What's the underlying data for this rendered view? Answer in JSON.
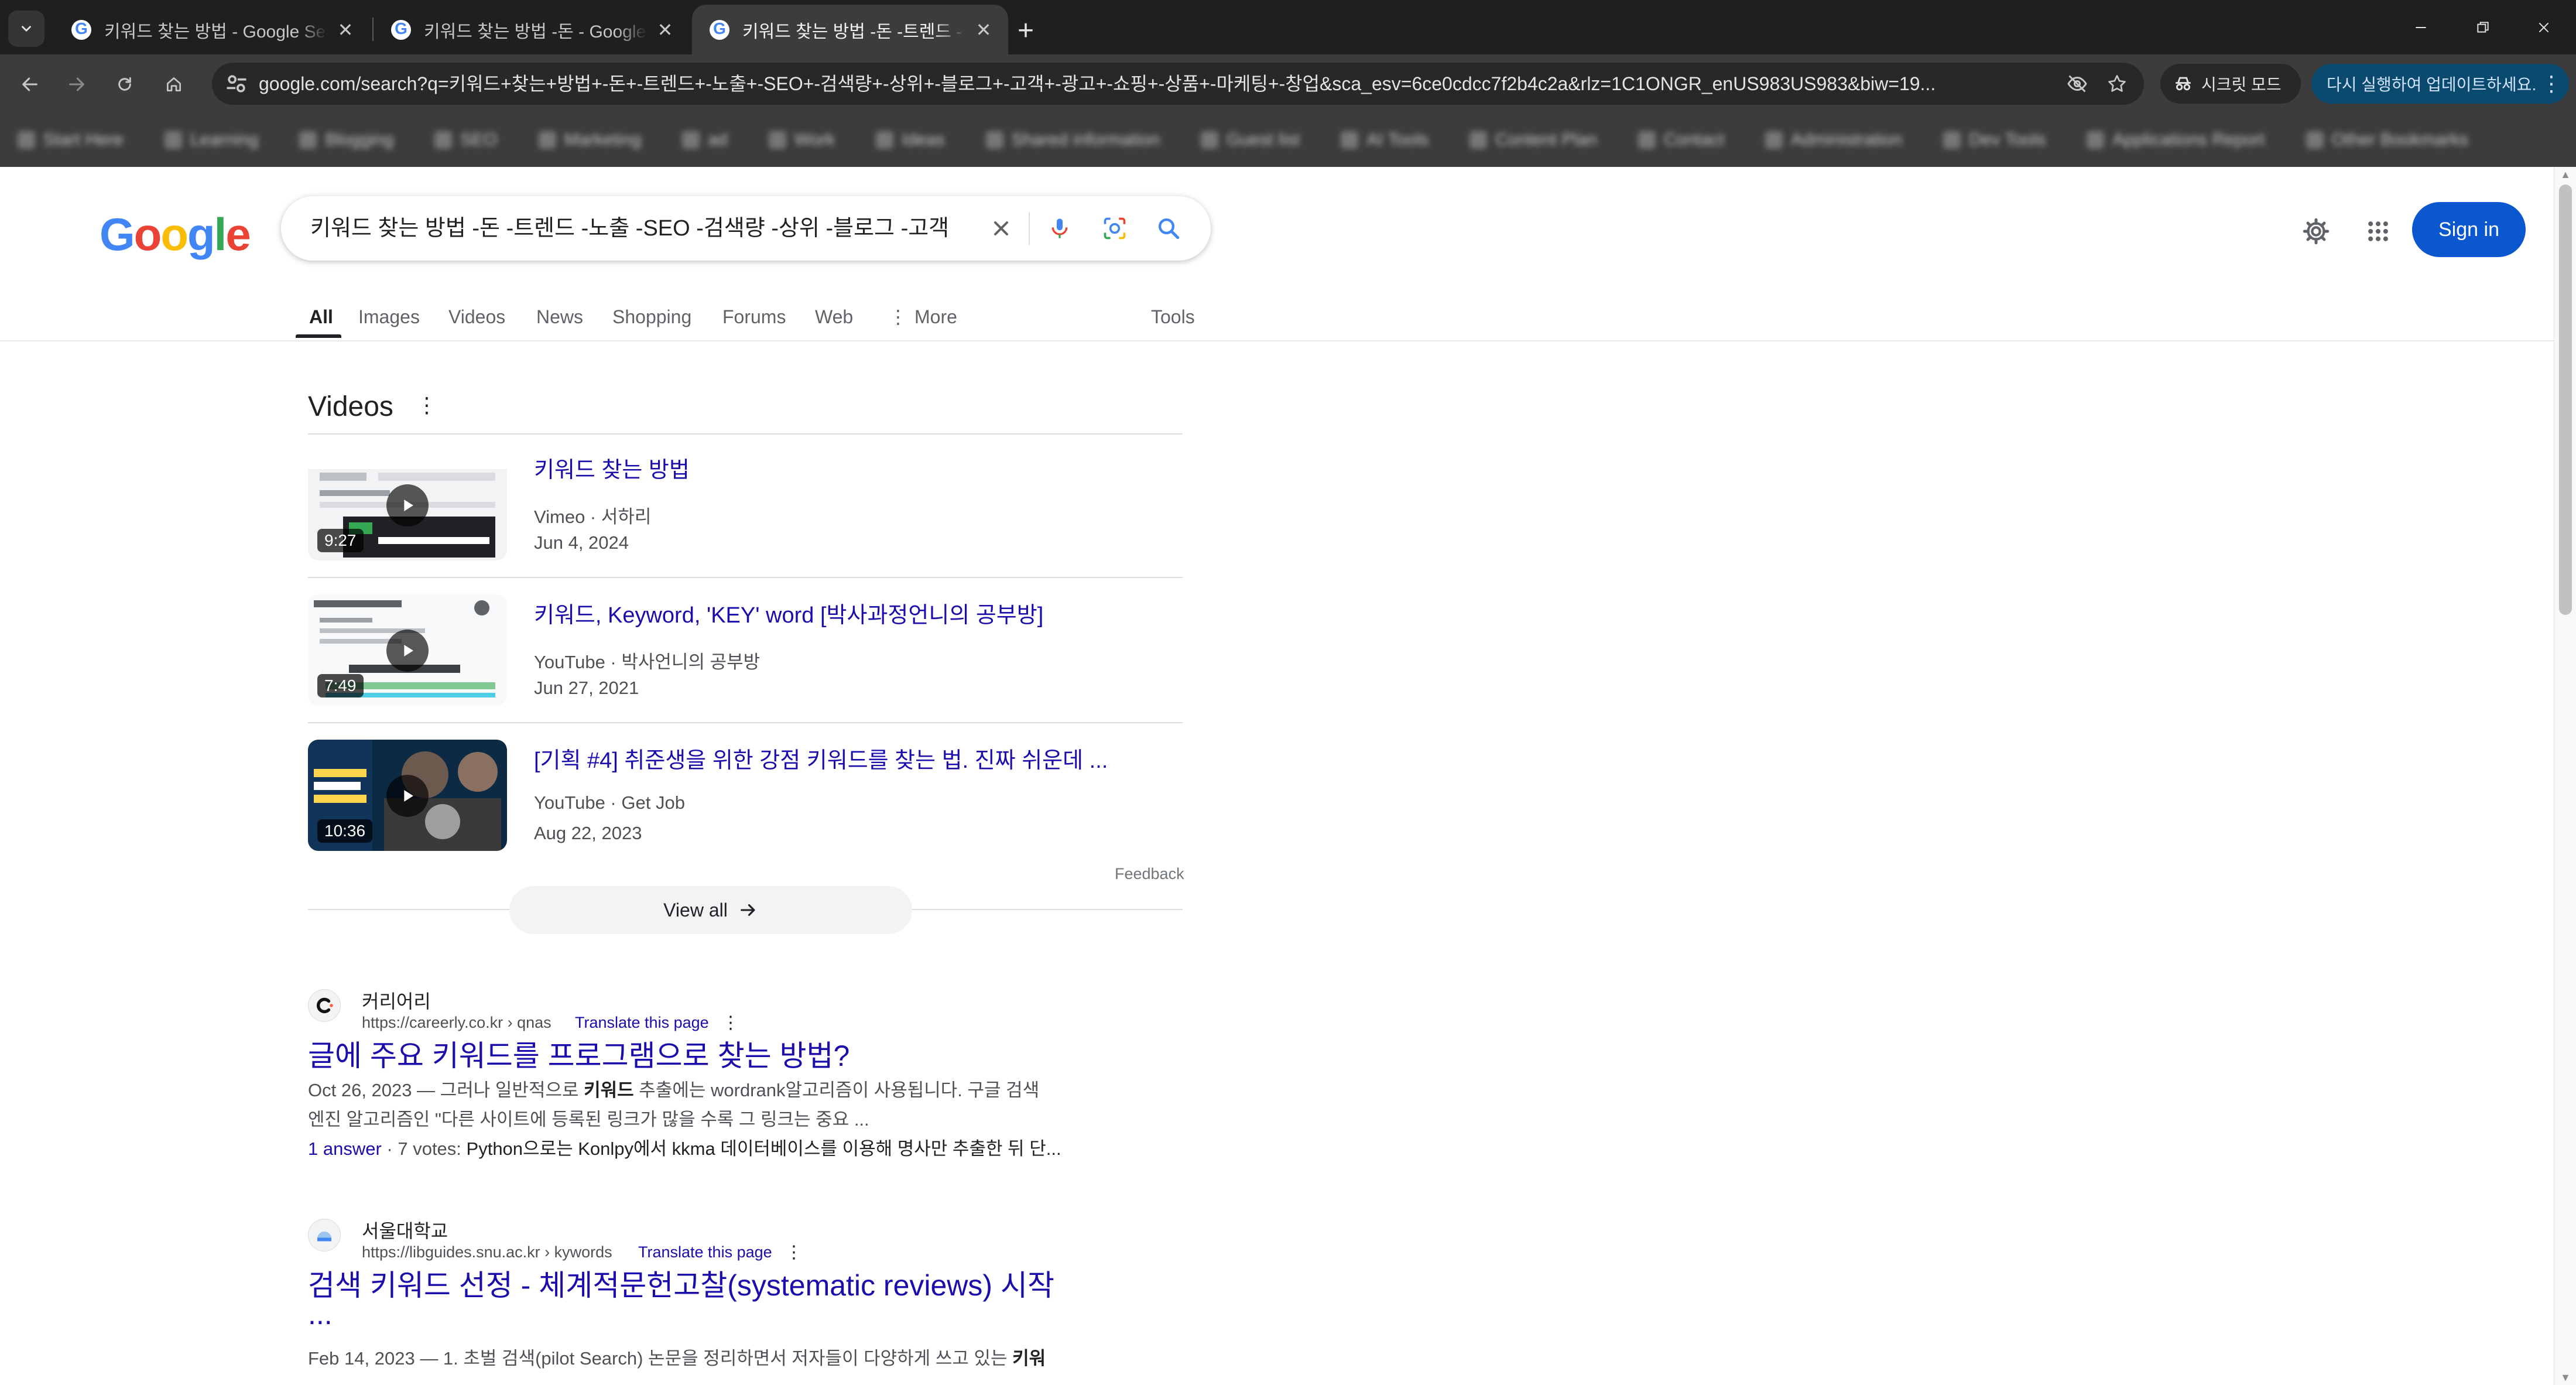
{
  "browser": {
    "tabs": [
      {
        "title": "키워드 찾는 방법 - Google Search"
      },
      {
        "title": "키워드 찾는 방법 -돈 - Google Search"
      },
      {
        "title": "키워드 찾는 방법 -돈 -트렌드 - Google Search"
      }
    ],
    "active_tab": 2,
    "url": "google.com/search?q=키워드+찾는+방법+-돈+-트렌드+-노출+-SEO+-검색량+-상위+-블로그+-고객+-광고+-쇼핑+-상품+-마케팅+-창업&sca_esv=6ce0cdcc7f2b4c2a&rlz=1C1ONGR_enUS983US983&biw=19...",
    "incognito_label": "시크릿 모드",
    "update_label": "다시 실행하여 업데이트하세요.",
    "bookmarks": [
      "Start Here",
      "Learning",
      "Blogging",
      "SEO",
      "Marketing",
      "ad",
      "Work",
      "Ideas",
      "Shared information",
      "Guest list",
      "AI Tools",
      "Content Plan",
      "Contact",
      "Administration",
      "Dev Tools",
      "Applications Report",
      "Other Bookmarks"
    ]
  },
  "google": {
    "logo_letters": [
      "G",
      "o",
      "o",
      "g",
      "l",
      "e"
    ],
    "query": "키워드 찾는 방법 -돈 -트렌드 -노출 -SEO -검색량 -상위 -블로그 -고객",
    "sign_in": "Sign in",
    "tabs": [
      "All",
      "Images",
      "Videos",
      "News",
      "Shopping",
      "Forums",
      "Web",
      "More",
      "Tools"
    ],
    "active_tab": "All"
  },
  "videos": {
    "heading": "Videos",
    "items": [
      {
        "title": "키워드 찾는 방법",
        "source": "Vimeo · 서하리",
        "date": "Jun 4, 2024",
        "duration": "9:27",
        "thumb_color": "#3c4043"
      },
      {
        "title": "키워드, Keyword, 'KEY' word [박사과정언니의 공부방]",
        "source": "YouTube · 박사언니의 공부방",
        "date": "Jun 27, 2021",
        "duration": "7:49",
        "thumb_color": "#e8eaed"
      },
      {
        "title": "[기획 #4] 취준생을 위한 강점 키워드를 찾는 법. 진짜 쉬운데 ...",
        "source": "YouTube · Get Job",
        "date": "Aug 22, 2023",
        "duration": "10:36",
        "thumb_color": "#1a3a5c"
      }
    ],
    "feedback": "Feedback",
    "view_all": "View all"
  },
  "results": [
    {
      "site": "커리어리",
      "url": "https://careerly.co.kr › qnas",
      "translate": "Translate this page",
      "title": "글에 주요 키워드를 프로그램으로 찾는 방법?",
      "snippet_line1_pre": "Oct 26, 2023 — 그러나 일반적으로 ",
      "snippet_line1_bold": "키워드",
      "snippet_line1_post": " 추출에는 wordrank알고리즘이 사용됩니다. 구글 검색",
      "snippet_line2": "엔진 알고리즘인 \"다른 사이트에 등록된 링크가 많을 수록 그 링크는 중요 ...",
      "answers_link": "1 answer",
      "answers_rest": " · 7 votes: ",
      "answers_text": "Python으로는 Konlpy에서 kkma 데이터베이스를 이용해 명사만 추출한 뒤 단..."
    },
    {
      "site": "서울대학교",
      "url": "https://libguides.snu.ac.kr › kywords",
      "translate": "Translate this page",
      "title": "검색 키워드 선정 - 체계적문헌고찰(systematic reviews) 시작",
      "title_cont": "...",
      "snippet_pre": "Feb 14, 2023 — 1. 초벌 검색(pilot Search) 논문을 정리하면서 저자들이 다양하게 쓰고 있는 ",
      "snippet_bold": "키워"
    }
  ],
  "colors": {
    "link": "#1a0dab",
    "primary_button": "#0b57d0",
    "chrome_dark": "#1f1f1f",
    "chrome_toolbar": "#3c3c3c"
  }
}
